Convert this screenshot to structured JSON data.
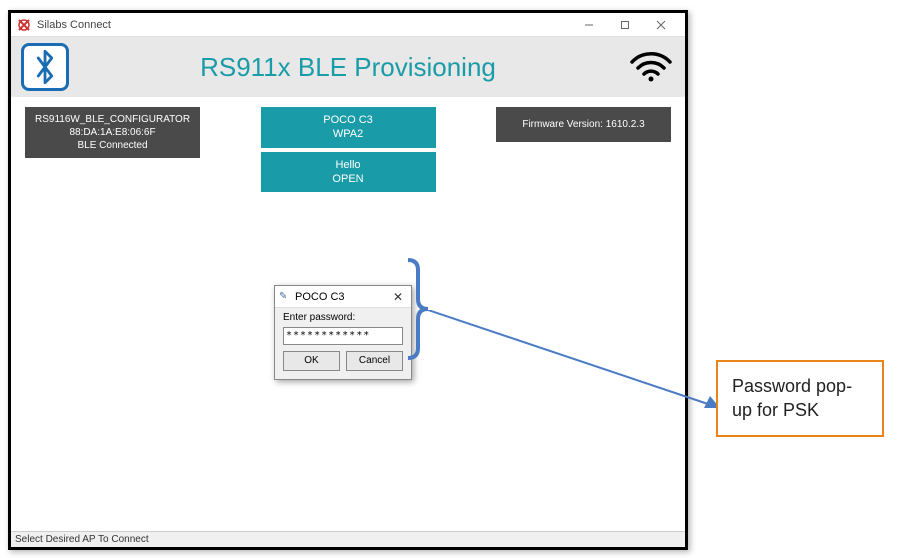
{
  "titlebar": {
    "text": "Silabs Connect"
  },
  "header": {
    "title": "RS911x BLE Provisioning"
  },
  "left_box": {
    "line1": "RS9116W_BLE_CONFIGURATOR",
    "line2": "88:DA:1A:E8:06:6F",
    "line3": "BLE Connected"
  },
  "aps": [
    {
      "ssid": "POCO C3",
      "security": "WPA2"
    },
    {
      "ssid": "Hello",
      "security": "OPEN"
    }
  ],
  "fw": {
    "label": "Firmware Version:  1610.2.3"
  },
  "statusbar": {
    "text": "Select Desired AP To Connect"
  },
  "popup": {
    "title": "POCO C3",
    "label": "Enter password:",
    "value": "************",
    "ok": "OK",
    "cancel": "Cancel"
  },
  "callout": {
    "text": "Password pop-up for PSK"
  }
}
